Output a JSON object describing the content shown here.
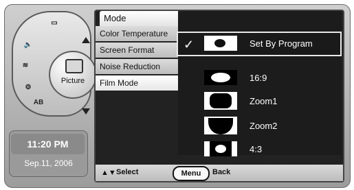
{
  "dial": {
    "center_label": "Picture",
    "icons": {
      "top": "tv-icon",
      "left": "speaker-icon",
      "mid": "antenna-icon",
      "bottom": "tools-icon",
      "ab": "AB"
    }
  },
  "clock": {
    "time": "11:20 PM",
    "date": "Sep.11, 2006"
  },
  "menu": {
    "title": "Mode",
    "items": [
      {
        "label": "Color Temperature"
      },
      {
        "label": "Screen Format"
      },
      {
        "label": "Noise Reduction"
      },
      {
        "label": "Film Mode"
      }
    ],
    "active_index": 3
  },
  "options": [
    {
      "label": "Set By Program",
      "selected": true,
      "icon": "set-by-program-icon"
    },
    {
      "label": "16:9",
      "selected": false,
      "icon": "ratio-16-9-icon"
    },
    {
      "label": "Zoom1",
      "selected": false,
      "icon": "zoom1-icon"
    },
    {
      "label": "Zoom2",
      "selected": false,
      "icon": "zoom2-icon"
    },
    {
      "label": "4:3",
      "selected": false,
      "icon": "ratio-4-3-icon"
    }
  ],
  "footer": {
    "arrows": "▲▼",
    "select": "Select",
    "menu": "Menu",
    "back": "Back"
  },
  "colors": {
    "panel": "#222222",
    "bezel": "#aaaaaa"
  }
}
